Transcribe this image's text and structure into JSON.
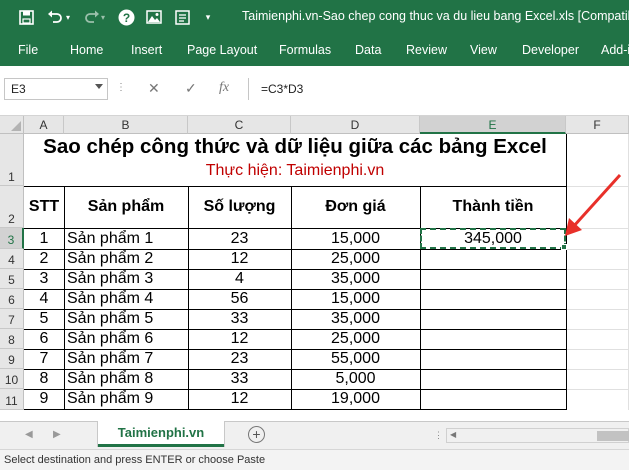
{
  "window": {
    "title": "Taimienphi.vn-Sao chep cong thuc va du lieu bang Excel.xls  [Compatibility"
  },
  "qat": {
    "icons": [
      "save-icon",
      "undo-icon",
      "redo-icon",
      "help-icon",
      "image-icon",
      "form-icon",
      "customize-icon"
    ]
  },
  "ribbon": {
    "tabs": [
      "File",
      "Home",
      "Insert",
      "Page Layout",
      "Formulas",
      "Data",
      "Review",
      "View",
      "Developer",
      "Add-i"
    ]
  },
  "formula_bar": {
    "name_box": "E3",
    "cancel": "✕",
    "enter": "✓",
    "fx": "fx",
    "formula": "=C3*D3"
  },
  "grid": {
    "columns": [
      "A",
      "B",
      "C",
      "D",
      "E",
      "F"
    ],
    "rows": [
      "1",
      "2",
      "3",
      "4",
      "5",
      "6",
      "7",
      "8",
      "9",
      "10",
      "11"
    ],
    "selected_column": "E",
    "selected_row": "3",
    "title": "Sao chép công thức và dữ liệu giữa các bảng Excel",
    "subtitle": "Thực hiện: Taimienphi.vn",
    "headers": [
      "STT",
      "Sản phẩm",
      "Số lượng",
      "Đơn giá",
      "Thành tiền"
    ],
    "data_rows": [
      {
        "stt": "1",
        "product": "Sản phẩm 1",
        "qty": "23",
        "price": "15,000",
        "total": "345,000"
      },
      {
        "stt": "2",
        "product": "Sản phẩm 2",
        "qty": "12",
        "price": "25,000",
        "total": ""
      },
      {
        "stt": "3",
        "product": "Sản phẩm 3",
        "qty": "4",
        "price": "35,000",
        "total": ""
      },
      {
        "stt": "4",
        "product": "Sản phẩm 4",
        "qty": "56",
        "price": "15,000",
        "total": ""
      },
      {
        "stt": "5",
        "product": "Sản phẩm 5",
        "qty": "33",
        "price": "35,000",
        "total": ""
      },
      {
        "stt": "6",
        "product": "Sản phẩm 6",
        "qty": "12",
        "price": "25,000",
        "total": ""
      },
      {
        "stt": "7",
        "product": "Sản phẩm 7",
        "qty": "23",
        "price": "55,000",
        "total": ""
      },
      {
        "stt": "8",
        "product": "Sản phẩm 8",
        "qty": "33",
        "price": "5,000",
        "total": ""
      },
      {
        "stt": "9",
        "product": "Sản phẩm 9",
        "qty": "12",
        "price": "19,000",
        "total": ""
      }
    ],
    "annotation_color": "#e8302a"
  },
  "sheets": {
    "active": "Taimienphi.vn",
    "add": "+"
  },
  "status": {
    "message": "Select destination and press ENTER or choose Paste"
  },
  "colors": {
    "brand": "#217346",
    "subtitle": "#c00000"
  }
}
